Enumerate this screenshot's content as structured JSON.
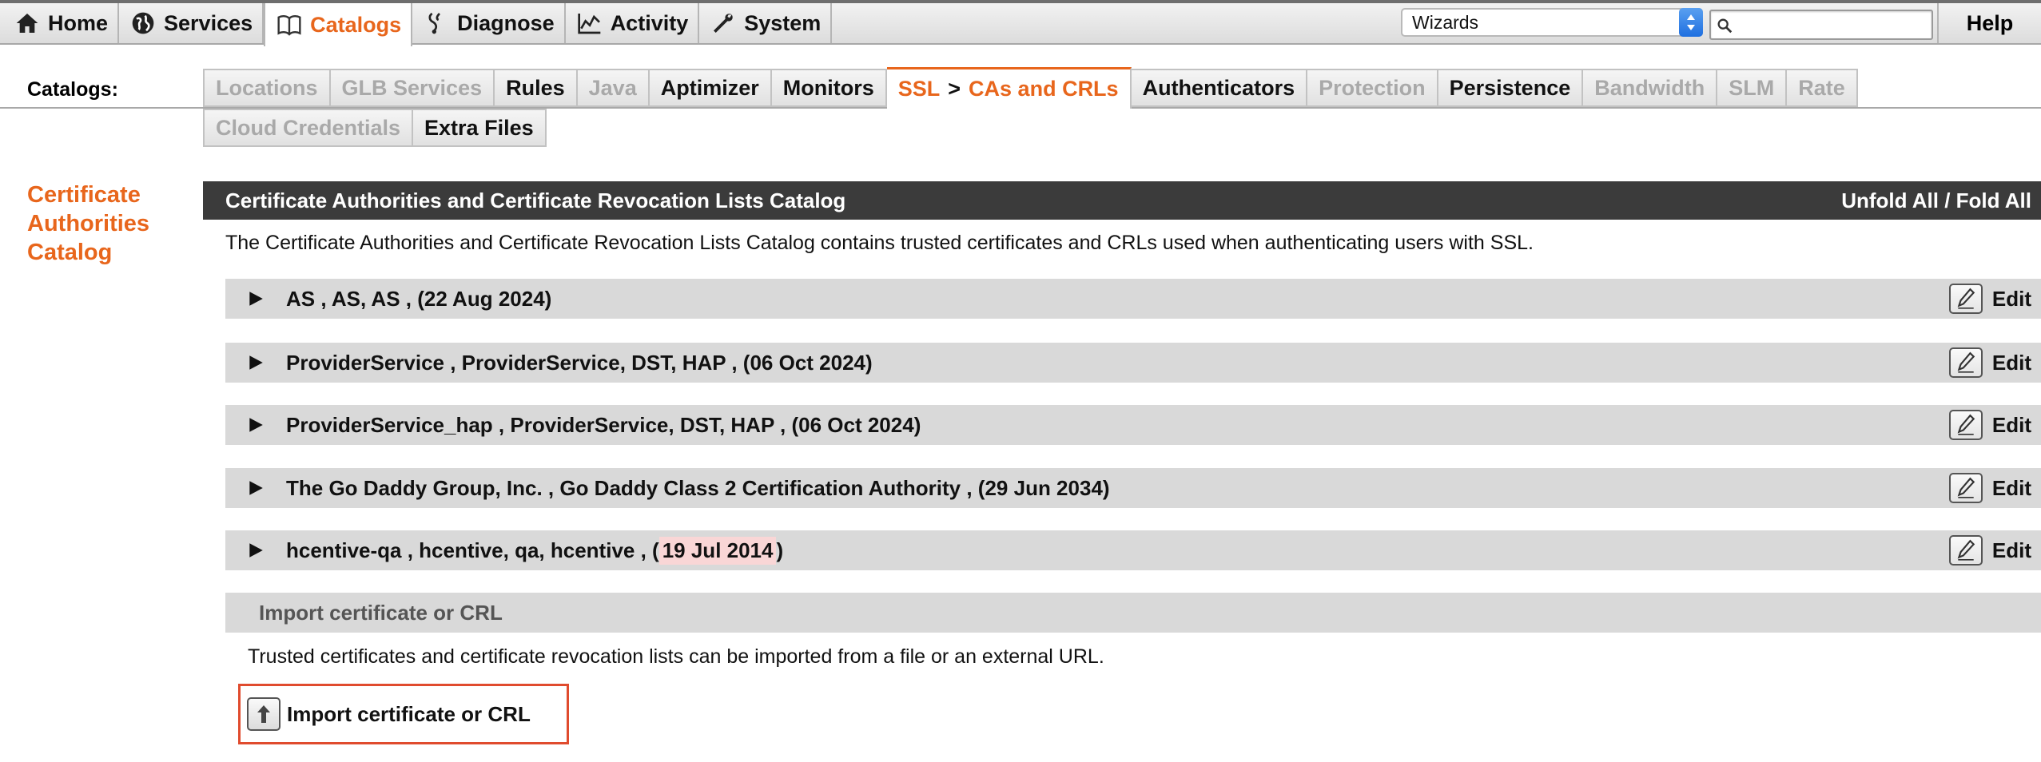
{
  "topnav": {
    "tabs": [
      {
        "label": "Home",
        "icon": "home-icon",
        "active": false
      },
      {
        "label": "Services",
        "icon": "globe-icon",
        "active": false
      },
      {
        "label": "Catalogs",
        "icon": "book-icon",
        "active": true
      },
      {
        "label": "Diagnose",
        "icon": "stethoscope-icon",
        "active": false
      },
      {
        "label": "Activity",
        "icon": "activity-chart-icon",
        "active": false
      },
      {
        "label": "System",
        "icon": "wrench-icon",
        "active": false
      }
    ],
    "wizards_value": "Wizards",
    "search_placeholder": "",
    "help_label": "Help"
  },
  "catalogs": {
    "label": "Catalogs:",
    "row1": [
      {
        "label": "Locations",
        "disabled": true
      },
      {
        "label": "GLB Services",
        "disabled": true
      },
      {
        "label": "Rules",
        "disabled": false
      },
      {
        "label": "Java",
        "disabled": true
      },
      {
        "label": "Aptimizer",
        "disabled": false
      },
      {
        "label": "Monitors",
        "disabled": false
      },
      {
        "label": "SSL",
        "label2": "CAs and CRLs",
        "separator": ">",
        "active": true
      },
      {
        "label": "Authenticators",
        "disabled": false
      },
      {
        "label": "Protection",
        "disabled": true
      },
      {
        "label": "Persistence",
        "disabled": false
      },
      {
        "label": "Bandwidth",
        "disabled": true
      },
      {
        "label": "SLM",
        "disabled": true
      },
      {
        "label": "Rate",
        "disabled": true
      }
    ],
    "row2": [
      {
        "label": "Cloud Credentials",
        "disabled": true
      },
      {
        "label": "Extra Files",
        "disabled": false
      }
    ]
  },
  "side_title": "Certificate Authorities Catalog",
  "panel": {
    "title": "Certificate Authorities and Certificate Revocation Lists Catalog",
    "unfold_label": "Unfold All / Fold All",
    "description": "The Certificate Authorities and Certificate Revocation Lists Catalog contains trusted certificates and CRLs used when authenticating users with SSL."
  },
  "certificates": [
    {
      "name": "AS ,  AS, AS ,  (",
      "expiry": "22 Aug 2024",
      "close": ")",
      "expired": false,
      "edit_label": "Edit"
    },
    {
      "name": "ProviderService ,  ProviderService, DST, HAP ,  (",
      "expiry": "06 Oct 2024",
      "close": ")",
      "expired": false,
      "edit_label": "Edit"
    },
    {
      "name": "ProviderService_hap ,  ProviderService, DST, HAP ,  (",
      "expiry": "06 Oct 2024",
      "close": ")",
      "expired": false,
      "edit_label": "Edit"
    },
    {
      "name": "The Go Daddy Group, Inc. ,  Go Daddy Class 2 Certification Authority ,  (",
      "expiry": "29 Jun 2034",
      "close": ")",
      "expired": false,
      "edit_label": "Edit"
    },
    {
      "name": "hcentive-qa ,  hcentive, qa, hcentive ,  (",
      "expiry": "19 Jul 2014",
      "close": ")",
      "expired": true,
      "edit_label": "Edit"
    }
  ],
  "import": {
    "section_title": "Import certificate or CRL",
    "description": "Trusted certificates and certificate revocation lists can be imported from a file or an external URL.",
    "button_label": "Import certificate or CRL"
  },
  "colors": {
    "accent": "#e8661c",
    "header_bg": "#3b3b3b",
    "row_bg": "#d9d9d9",
    "expired_bg": "#f9d6d6",
    "highlight_border": "#e04b2e"
  }
}
